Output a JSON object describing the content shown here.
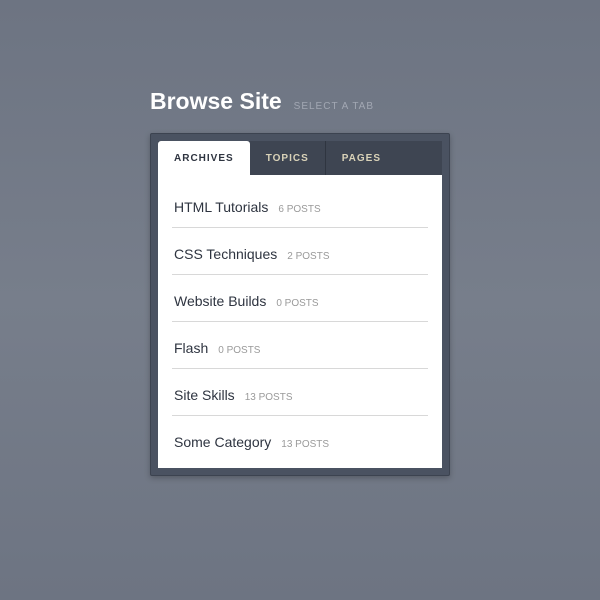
{
  "header": {
    "title": "Browse Site",
    "subtitle": "SELECT A TAB"
  },
  "tabs": [
    {
      "label": "ARCHIVES",
      "active": true
    },
    {
      "label": "TOPICS",
      "active": false
    },
    {
      "label": "PAGES",
      "active": false
    }
  ],
  "archives": [
    {
      "title": "HTML Tutorials",
      "meta": "6 POSTS"
    },
    {
      "title": "CSS Techniques",
      "meta": "2 POSTS"
    },
    {
      "title": "Website Builds",
      "meta": "0 POSTS"
    },
    {
      "title": "Flash",
      "meta": "0 POSTS"
    },
    {
      "title": "Site Skills",
      "meta": "13 POSTS"
    },
    {
      "title": "Some Category",
      "meta": "13 POSTS"
    }
  ]
}
